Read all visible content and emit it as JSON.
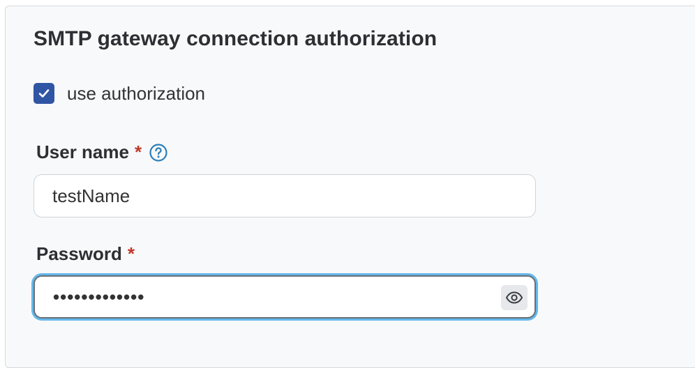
{
  "section": {
    "title": "SMTP gateway connection authorization"
  },
  "use_authorization": {
    "label": "use authorization",
    "checked": true
  },
  "username": {
    "label": "User name",
    "required_mark": "*",
    "help_icon": "question-circle-icon",
    "value": "testName"
  },
  "password": {
    "label": "Password",
    "required_mark": "*",
    "masked_value": "•••••••••••••",
    "toggle_icon": "eye-icon",
    "focused": true
  },
  "colors": {
    "accent": "#2f55a4",
    "required": "#c0392b",
    "help": "#2a7fb8",
    "focus_ring": "#63b8ec"
  }
}
